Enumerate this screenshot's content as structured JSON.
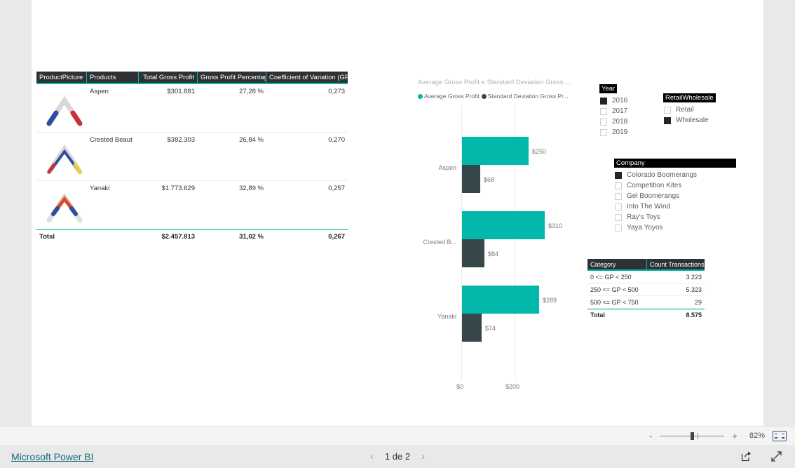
{
  "report": {
    "product_table": {
      "columns": [
        "ProductPicture",
        "Products",
        "Total Gross Profit",
        "Gross Profit Percentage",
        "Coefficient of Variation (GP)"
      ],
      "rows": [
        {
          "picture": "boomerang-red-white-blue-icon",
          "product": "Aspen",
          "total_gross_profit": "$301.881",
          "gross_profit_percentage": "27,28 %",
          "coefficient_of_variation": "0,273"
        },
        {
          "picture": "boomerang-blue-yellow-icon",
          "product": "Crested Beaut",
          "total_gross_profit": "$382.303",
          "gross_profit_percentage": "26,84 %",
          "coefficient_of_variation": "0,270"
        },
        {
          "picture": "boomerang-rainbow-icon",
          "product": "Yanaki",
          "total_gross_profit": "$1.773.629",
          "gross_profit_percentage": "32,89 %",
          "coefficient_of_variation": "0,257"
        }
      ],
      "total": {
        "label": "Total",
        "picture": "",
        "total_gross_profit": "$2.457.813",
        "gross_profit_percentage": "31,02 %",
        "coefficient_of_variation": "0,267"
      }
    },
    "slicers": [
      {
        "name": "Year",
        "title": "Year",
        "items": [
          {
            "label": "2016",
            "checked": true
          },
          {
            "label": "2017",
            "checked": false
          },
          {
            "label": "2018",
            "checked": false
          },
          {
            "label": "2019",
            "checked": false
          }
        ]
      },
      {
        "name": "RetailWholesale",
        "title": "RetailWholesale",
        "items": [
          {
            "label": "Retail",
            "checked": false
          },
          {
            "label": "Wholesale",
            "checked": true
          }
        ]
      },
      {
        "name": "Company",
        "title": "Company",
        "items": [
          {
            "label": "Colorado Boomerangs",
            "checked": true
          },
          {
            "label": "Competition Kites",
            "checked": false
          },
          {
            "label": "Gel Boomerangs",
            "checked": false
          },
          {
            "label": "Into The Wind",
            "checked": false
          },
          {
            "label": "Ray's Toys",
            "checked": false
          },
          {
            "label": "Yaya Yoyos",
            "checked": false
          }
        ]
      }
    ],
    "category_table": {
      "columns": [
        "Category",
        "Count Transactions"
      ],
      "rows": [
        {
          "category": "0 <= GP < 250",
          "count": "3.223"
        },
        {
          "category": "250 <= GP < 500",
          "count": "5.323"
        },
        {
          "category": "500 <= GP < 750",
          "count": "29"
        }
      ],
      "total": {
        "label": "Total",
        "count": "8.575"
      }
    }
  },
  "chart_data": {
    "type": "bar",
    "orientation": "horizontal",
    "title": "Average Gross Profit e Standard Deviation Gross ...",
    "categories": [
      "Aspen",
      "Crested B...",
      "Yanaki"
    ],
    "series": [
      {
        "name": "Average Gross Profit",
        "color": "#01b8aa",
        "values": [
          250,
          310,
          289
        ],
        "labels": [
          "$250",
          "$310",
          "$289"
        ]
      },
      {
        "name": "Standard Deviation Gross Pr...",
        "color": "#374649",
        "values": [
          68,
          84,
          74
        ],
        "labels": [
          "$68",
          "$84",
          "$74"
        ]
      }
    ],
    "xlabel": "",
    "ylabel": "",
    "xticks": [
      "$0",
      "$200"
    ],
    "xtick_values": [
      0,
      200
    ],
    "xlim": [
      0,
      360
    ],
    "grid": true,
    "legend_position": "top"
  },
  "chrome": {
    "zoom": {
      "minus_label": "-",
      "plus_label": "+",
      "percent": "82%",
      "fit_icon": "fit-to-page-icon"
    },
    "footer": {
      "brand_link": "Microsoft Power BI",
      "prev_icon": "chevron-left-icon",
      "page_indicator": "1 de 2",
      "next_icon": "chevron-right-icon",
      "share_icon": "share-icon",
      "fullscreen_icon": "fullscreen-icon"
    }
  },
  "colors": {
    "accent_teal": "#01b8aa",
    "accent_dark": "#374649",
    "header_bg": "#2f3234",
    "link": "#16697a"
  }
}
